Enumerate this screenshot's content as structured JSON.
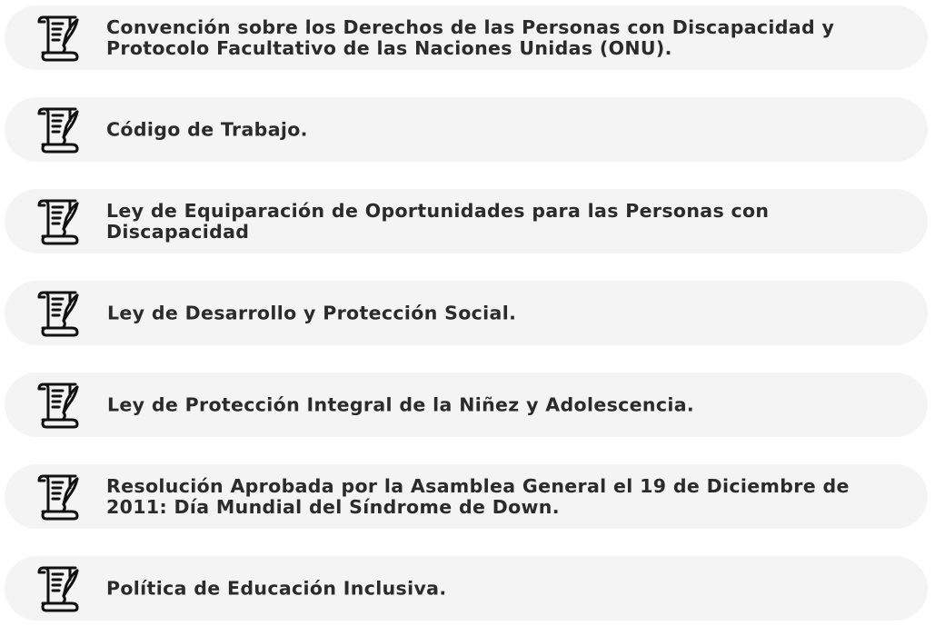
{
  "items": [
    {
      "icon": "scroll-document-icon",
      "label": "Convención sobre los Derechos de las Personas con Discapacidad y Protocolo Facultativo de las Naciones Unidas (ONU)."
    },
    {
      "icon": "scroll-document-icon",
      "label": "Código de Trabajo."
    },
    {
      "icon": "scroll-document-icon",
      "label": "Ley de Equiparación de Oportunidades para las Personas con Discapacidad"
    },
    {
      "icon": "scroll-document-icon",
      "label": "Ley de Desarrollo y Protección Social."
    },
    {
      "icon": "scroll-document-icon",
      "label": "Ley de Protección Integral de la Niñez y Adolescencia."
    },
    {
      "icon": "scroll-document-icon",
      "label": "Resolución Aprobada por la Asamblea General el 19 de Diciembre de 2011: Día Mundial del Síndrome de Down."
    },
    {
      "icon": "scroll-document-icon",
      "label": "Política de Educación Inclusiva."
    }
  ],
  "colors": {
    "card_background": "#f4f4f4",
    "text": "#2b2b2b",
    "icon": "#111111"
  }
}
